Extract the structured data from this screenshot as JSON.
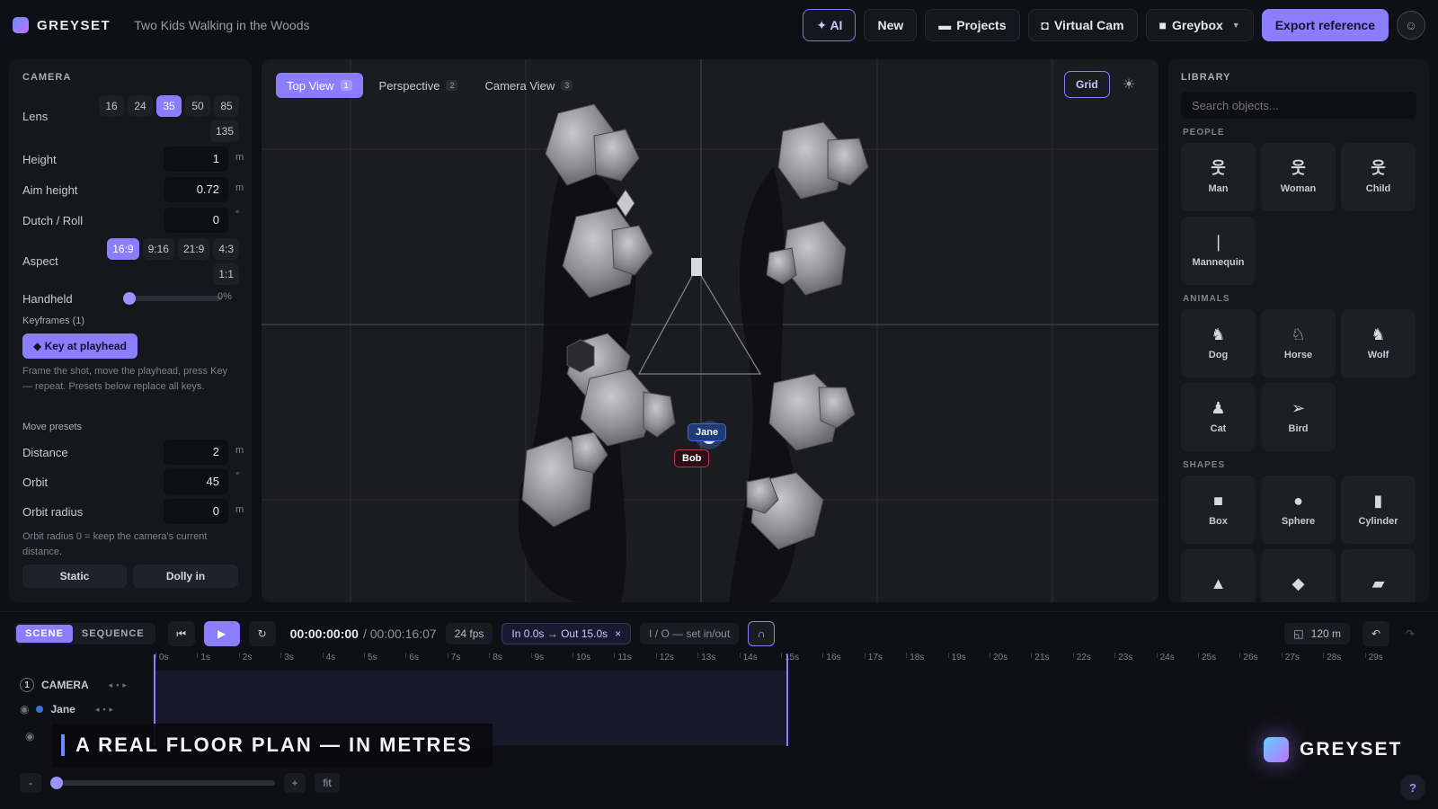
{
  "app": {
    "brand": "GREYSET",
    "project_title": "Two Kids Walking in the Woods"
  },
  "topbar": {
    "ai": "✦ AI",
    "new": "New",
    "projects": "Projects",
    "virtual_cam": "Virtual Cam",
    "greybox": "Greybox",
    "export": "Export reference"
  },
  "camera": {
    "section": "CAMERA",
    "lens_label": "Lens",
    "lens_options": [
      "16",
      "24",
      "35",
      "50",
      "85",
      "135"
    ],
    "lens_selected": "35",
    "height_label": "Height",
    "height_value": "1",
    "height_unit": "m",
    "aim_label": "Aim height",
    "aim_value": "0.72",
    "aim_unit": "m",
    "dutch_label": "Dutch / Roll",
    "dutch_value": "0",
    "dutch_unit": "°",
    "aspect_label": "Aspect",
    "aspect_options": [
      "16:9",
      "9:16",
      "21:9",
      "4:3",
      "1:1"
    ],
    "aspect_selected": "16:9",
    "handheld_label": "Handheld",
    "handheld_value": "0%",
    "handheld_level": 0,
    "keyframes_label": "Keyframes (1)",
    "key_button": "◆ Key at playhead",
    "key_hint": "Frame the shot, move the playhead, press Key — repeat. Presets below replace all keys.",
    "move_presets_label": "Move presets",
    "distance_label": "Distance",
    "distance_value": "2",
    "distance_unit": "m",
    "orbit_label": "Orbit",
    "orbit_value": "45",
    "orbit_unit": "°",
    "orbit_radius_label": "Orbit radius",
    "orbit_radius_value": "0",
    "orbit_radius_unit": "m",
    "orbit_hint": "Orbit radius 0 = keep the camera's current distance.",
    "static_button": "Static",
    "dolly_button": "Dolly in"
  },
  "viewport": {
    "tabs": [
      {
        "label": "Top View",
        "key": "1"
      },
      {
        "label": "Perspective",
        "key": "2"
      },
      {
        "label": "Camera View",
        "key": "3"
      }
    ],
    "grid_button": "Grid",
    "characters": [
      "Jane",
      "Bob"
    ]
  },
  "library": {
    "title": "LIBRARY",
    "search_placeholder": "Search objects...",
    "people_label": "PEOPLE",
    "people": [
      {
        "label": "Man",
        "icon": "person-icon"
      },
      {
        "label": "Woman",
        "icon": "person-icon"
      },
      {
        "label": "Child",
        "icon": "person-icon"
      },
      {
        "label": "Mannequin",
        "icon": "mannequin-icon"
      }
    ],
    "animals_label": "ANIMALS",
    "animals": [
      {
        "label": "Dog",
        "icon": "dog-icon"
      },
      {
        "label": "Horse",
        "icon": "horse-icon"
      },
      {
        "label": "Wolf",
        "icon": "wolf-icon"
      },
      {
        "label": "Cat",
        "icon": "cat-icon"
      },
      {
        "label": "Bird",
        "icon": "bird-icon"
      }
    ],
    "shapes_label": "SHAPES",
    "shapes": [
      {
        "label": "Box",
        "icon": "box-icon"
      },
      {
        "label": "Sphere",
        "icon": "sphere-icon"
      },
      {
        "label": "Cylinder",
        "icon": "cylinder-icon"
      }
    ]
  },
  "timeline": {
    "scene_tab": "SCENE",
    "sequence_tab": "SEQUENCE",
    "timecode": "00:00:00:00",
    "duration": "/ 00:00:16:07",
    "fps": "24 fps",
    "inout": "In 0.0s → Out 15.0s",
    "inout_close": "×",
    "set_inout": "I / O — set in/out",
    "distance_readout": "120 m",
    "ticks": [
      "0s",
      "1s",
      "2s",
      "3s",
      "4s",
      "5s",
      "6s",
      "7s",
      "8s",
      "9s",
      "10s",
      "11s",
      "12s",
      "13s",
      "14s",
      "15s",
      "16s",
      "17s",
      "18s",
      "19s",
      "20s",
      "21s",
      "22s",
      "23s",
      "24s",
      "25s",
      "26s",
      "27s",
      "28s",
      "29s"
    ],
    "tracks": [
      {
        "index": "1",
        "name": "CAMERA"
      },
      {
        "name": "Jane"
      }
    ],
    "zoom_minus": "-",
    "zoom_plus": "+",
    "zoom_fit": "fit"
  },
  "overlay": {
    "caption": "A REAL FLOOR PLAN — IN METRES",
    "watermark": "GREYSET"
  },
  "colors": {
    "accent": "#8a7dff",
    "jane": "#3d6fd8",
    "bob": "#c2334a"
  }
}
